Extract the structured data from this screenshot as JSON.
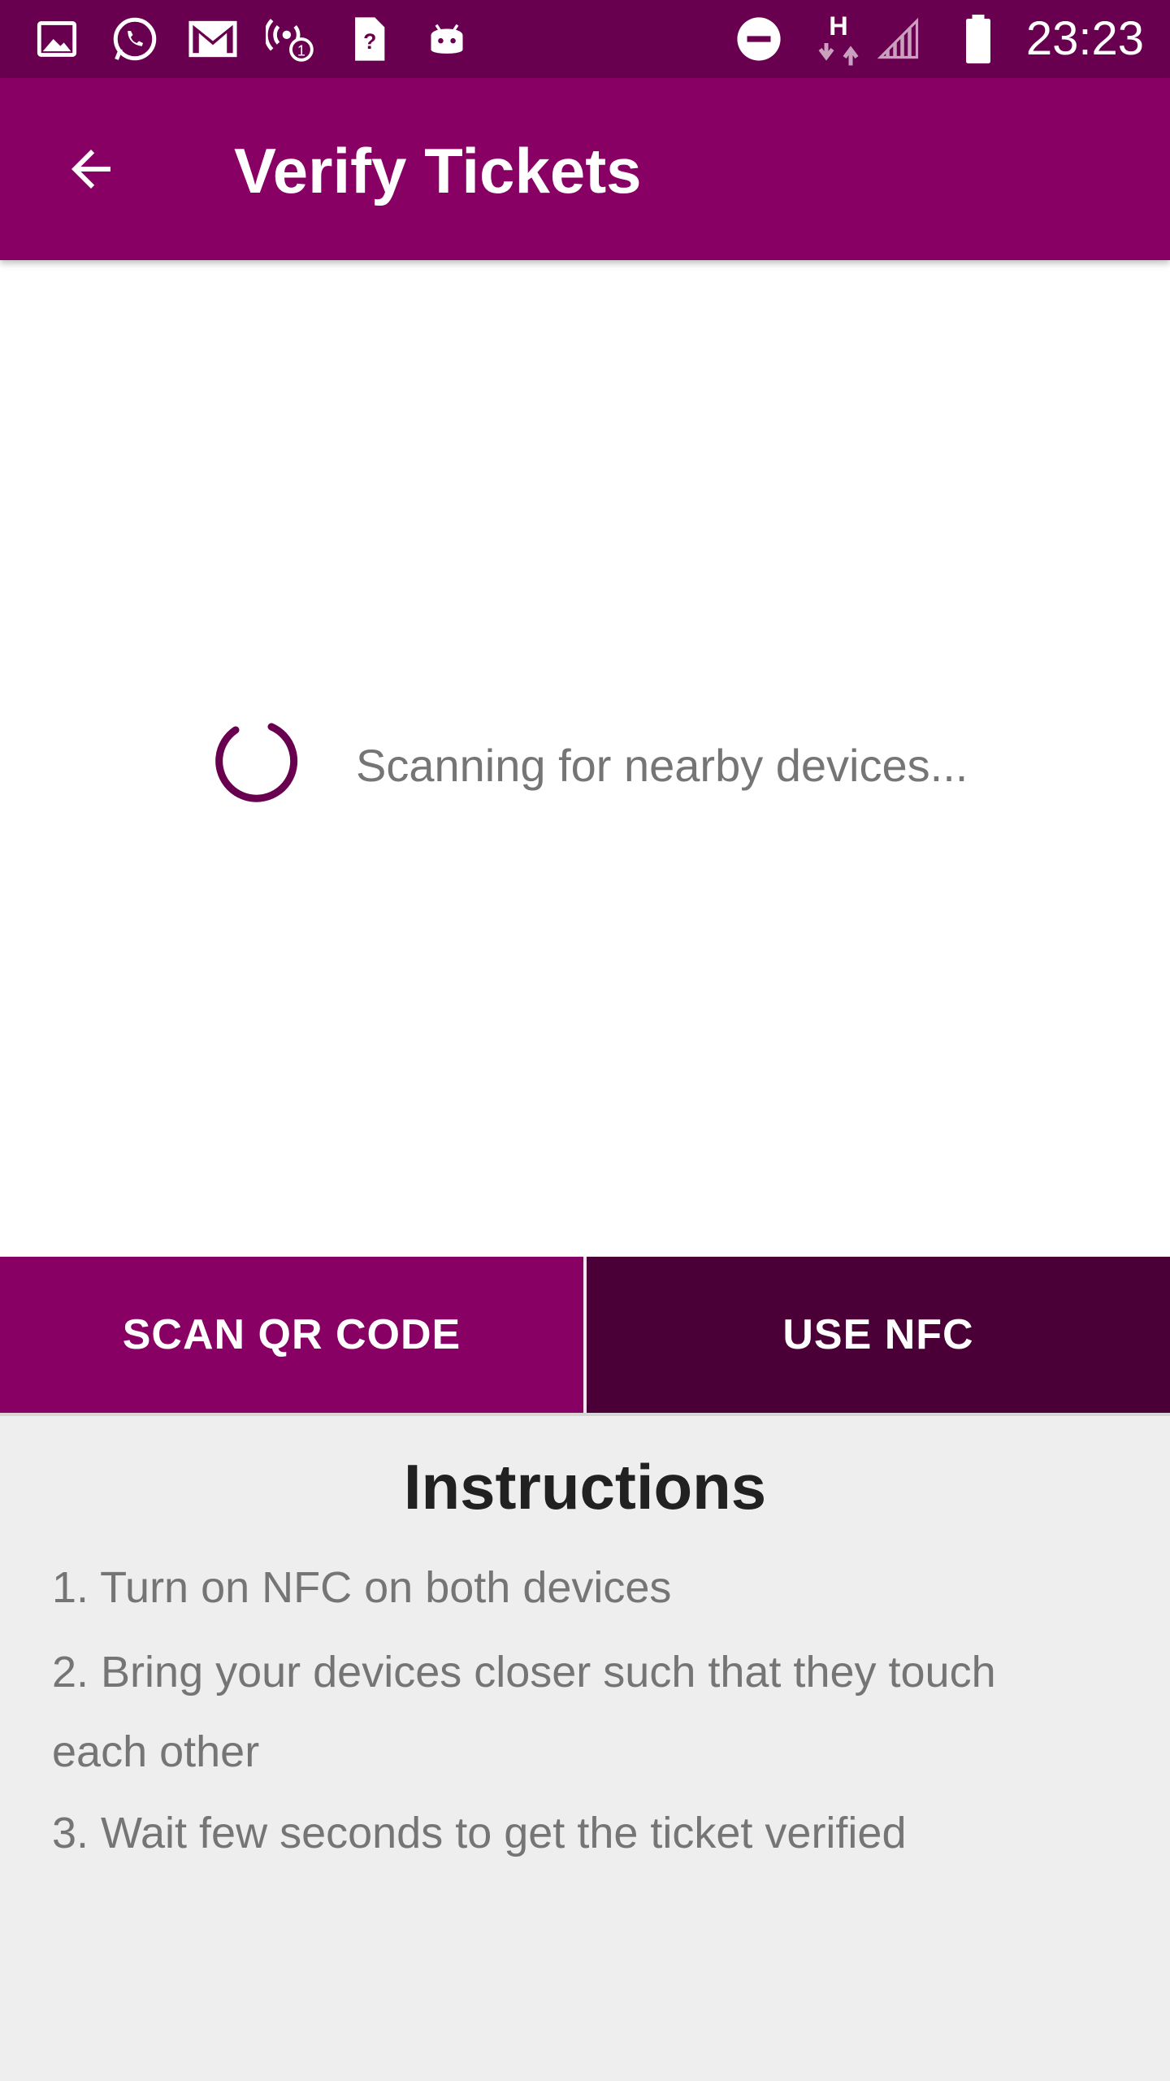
{
  "status_bar": {
    "time": "23:23",
    "left_icons": [
      "image-icon",
      "whatsapp-icon",
      "gmail-icon",
      "hotspot-icon",
      "sim-icon",
      "android-icon"
    ],
    "right_icons": [
      "dnd-icon",
      "network-h-icon",
      "signal-icon",
      "battery-icon"
    ],
    "network_label": "H"
  },
  "app_bar": {
    "title": "Verify Tickets",
    "back_icon": "arrow-back-icon",
    "color": "#880064"
  },
  "scan": {
    "status_text": "Scanning for nearby devices...",
    "spinner_color": "#69004f"
  },
  "buttons": {
    "scan_qr_label": "SCAN QR CODE",
    "use_nfc_label": "USE NFC"
  },
  "instructions": {
    "title": "Instructions",
    "step1": "1. Turn on NFC on both devices",
    "step2_line1": "2. Bring your devices closer such that they touch",
    "step2_line2": "each other",
    "step3": "3. Wait few seconds to get the ticket verified"
  }
}
